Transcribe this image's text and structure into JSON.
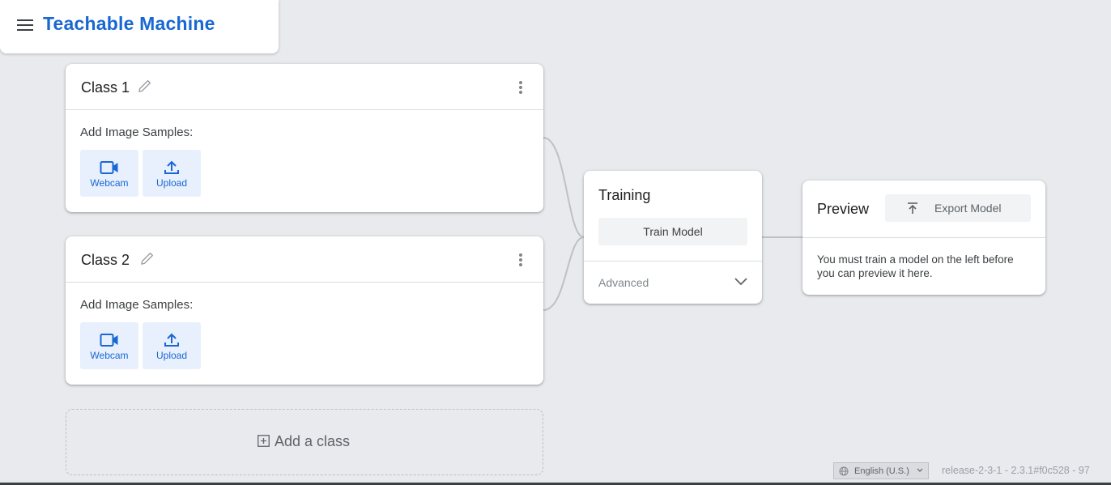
{
  "header": {
    "app_title": "Teachable Machine"
  },
  "classes": [
    {
      "title": "Class 1",
      "samples_label": "Add Image Samples:",
      "webcam_label": "Webcam",
      "upload_label": "Upload"
    },
    {
      "title": "Class 2",
      "samples_label": "Add Image Samples:",
      "webcam_label": "Webcam",
      "upload_label": "Upload"
    }
  ],
  "add_class": {
    "label": "Add a class"
  },
  "training": {
    "title": "Training",
    "train_button": "Train Model",
    "advanced_label": "Advanced"
  },
  "preview": {
    "title": "Preview",
    "export_button": "Export Model",
    "message": "You must train a model on the left before you can preview it here."
  },
  "footer": {
    "language": "English (U.S.)",
    "release": "release-2-3-1 - 2.3.1#f0c528 - 97"
  },
  "colors": {
    "accent": "#1967d2",
    "background": "#e8eaed",
    "sample_button_bg": "#e8f0fe"
  }
}
